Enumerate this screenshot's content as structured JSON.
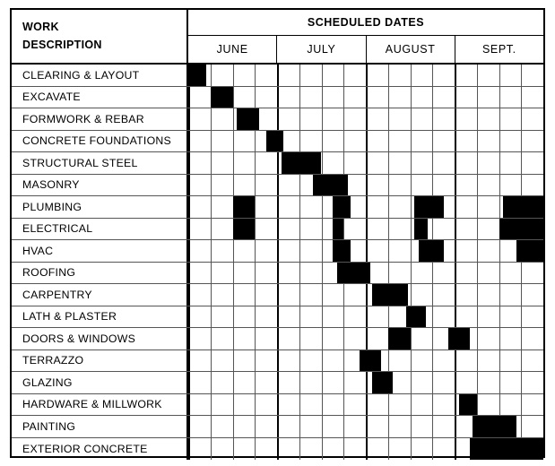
{
  "header": {
    "work_description_line1": "WORK",
    "work_description_line2": "DESCRIPTION",
    "scheduled_dates_title": "SCHEDULED DATES",
    "months": [
      "JUNE",
      "JULY",
      "AUGUST",
      "SEPT."
    ]
  },
  "chart_data": {
    "type": "bar",
    "title": "SCHEDULED DATES",
    "xlabel": "",
    "ylabel": "WORK DESCRIPTION",
    "columns_per_month": 4,
    "total_columns": 16,
    "categories": [
      "CLEARING & LAYOUT",
      "EXCAVATE",
      "FORMWORK & REBAR",
      "CONCRETE FOUNDATIONS",
      "STRUCTURAL STEEL",
      "MASONRY",
      "PLUMBING",
      "ELECTRICAL",
      "HVAC",
      "ROOFING",
      "CARPENTRY",
      "LATH & PLASTER",
      "DOORS & WINDOWS",
      "TERRAZZO",
      "GLAZING",
      "HARDWARE & MILLWORK",
      "PAINTING",
      "EXTERIOR CONCRETE"
    ],
    "tasks": [
      {
        "label": "CLEARING & LAYOUT",
        "bars": [
          {
            "start": 0.0,
            "end": 0.8
          }
        ]
      },
      {
        "label": "EXCAVATE",
        "bars": [
          {
            "start": 1.0,
            "end": 2.0
          }
        ]
      },
      {
        "label": "FORMWORK & REBAR",
        "bars": [
          {
            "start": 2.2,
            "end": 3.2
          }
        ]
      },
      {
        "label": "CONCRETE FOUNDATIONS",
        "bars": [
          {
            "start": 3.5,
            "end": 4.3
          }
        ]
      },
      {
        "label": "STRUCTURAL STEEL",
        "bars": [
          {
            "start": 4.2,
            "end": 6.0
          }
        ]
      },
      {
        "label": "MASONRY",
        "bars": [
          {
            "start": 5.6,
            "end": 7.2
          }
        ]
      },
      {
        "label": "PLUMBING",
        "bars": [
          {
            "start": 2.0,
            "end": 3.0
          },
          {
            "start": 6.5,
            "end": 7.3
          },
          {
            "start": 10.2,
            "end": 11.5
          },
          {
            "start": 14.2,
            "end": 16.0
          }
        ]
      },
      {
        "label": "ELECTRICAL",
        "bars": [
          {
            "start": 2.0,
            "end": 3.0
          },
          {
            "start": 6.5,
            "end": 7.0
          },
          {
            "start": 10.2,
            "end": 10.8
          },
          {
            "start": 14.0,
            "end": 16.0
          }
        ]
      },
      {
        "label": "HVAC",
        "bars": [
          {
            "start": 6.5,
            "end": 7.3
          },
          {
            "start": 10.4,
            "end": 11.5
          },
          {
            "start": 14.8,
            "end": 16.0
          }
        ]
      },
      {
        "label": "ROOFING",
        "bars": [
          {
            "start": 6.7,
            "end": 8.2
          }
        ]
      },
      {
        "label": "CARPENTRY",
        "bars": [
          {
            "start": 8.3,
            "end": 9.9
          }
        ]
      },
      {
        "label": "LATH & PLASTER",
        "bars": [
          {
            "start": 9.8,
            "end": 10.7
          }
        ]
      },
      {
        "label": "DOORS & WINDOWS",
        "bars": [
          {
            "start": 9.0,
            "end": 10.0
          },
          {
            "start": 11.7,
            "end": 12.7
          }
        ]
      },
      {
        "label": "TERRAZZO",
        "bars": [
          {
            "start": 7.7,
            "end": 8.7
          }
        ]
      },
      {
        "label": "GLAZING",
        "bars": [
          {
            "start": 8.3,
            "end": 9.2
          }
        ]
      },
      {
        "label": "HARDWARE & MILLWORK",
        "bars": [
          {
            "start": 12.2,
            "end": 13.0
          }
        ]
      },
      {
        "label": "PAINTING",
        "bars": [
          {
            "start": 12.8,
            "end": 14.8
          }
        ]
      },
      {
        "label": "EXTERIOR CONCRETE",
        "bars": [
          {
            "start": 12.7,
            "end": 16.0
          }
        ]
      }
    ]
  }
}
